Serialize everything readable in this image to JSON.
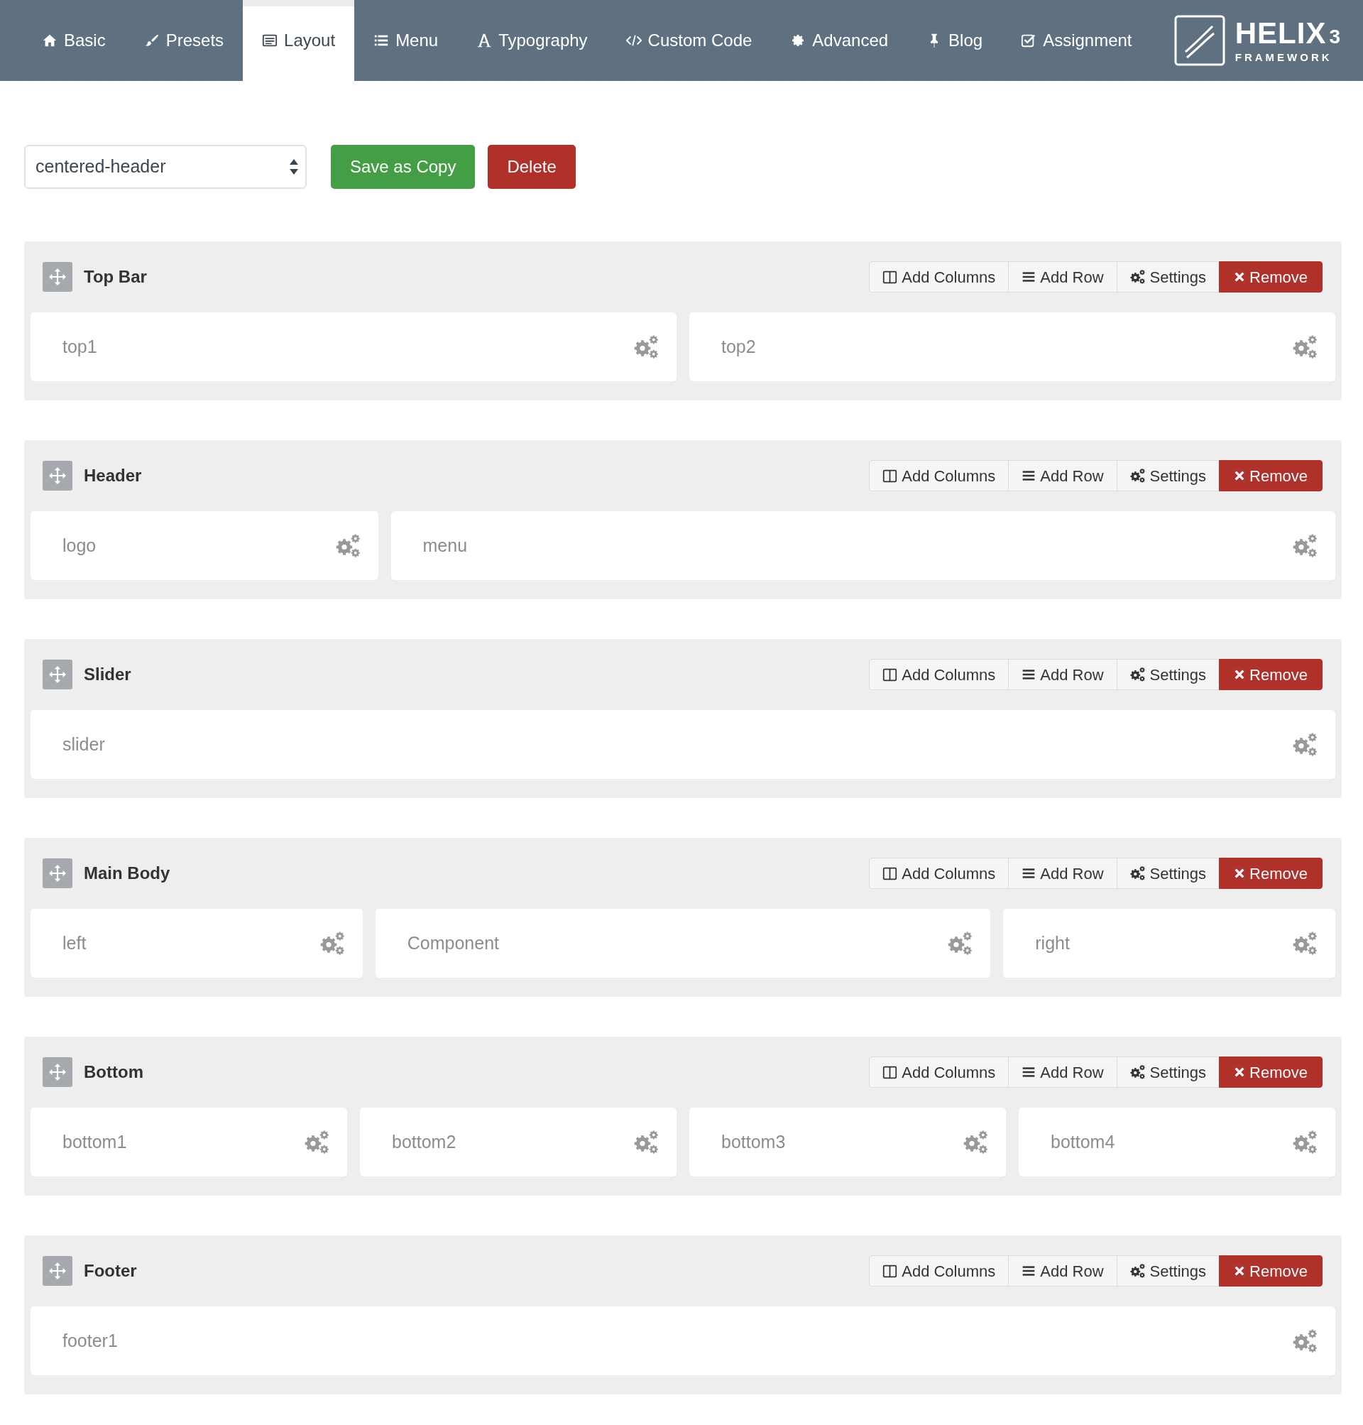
{
  "tabs": [
    {
      "label": "Basic",
      "kind": "home",
      "selected": false
    },
    {
      "label": "Presets",
      "kind": "brush",
      "selected": false
    },
    {
      "label": "Layout",
      "kind": "layout",
      "selected": true
    },
    {
      "label": "Menu",
      "kind": "list",
      "selected": false
    },
    {
      "label": "Typography",
      "kind": "font",
      "selected": false
    },
    {
      "label": "Custom Code",
      "kind": "code",
      "selected": false
    },
    {
      "label": "Advanced",
      "kind": "gear",
      "selected": false
    },
    {
      "label": "Blog",
      "kind": "pin",
      "selected": false
    },
    {
      "label": "Assignment",
      "kind": "check",
      "selected": false
    }
  ],
  "logo": {
    "name": "HELIX",
    "version": "3",
    "tagline": "FRAMEWORK"
  },
  "layout_select": {
    "value": "centered-header"
  },
  "actions": [
    {
      "label": "Save as Copy",
      "kind": "save"
    },
    {
      "label": "Delete",
      "kind": "delete"
    }
  ],
  "sections": [
    {
      "title": "Top Bar",
      "tools": [
        {
          "label": "Add Columns",
          "kind": "columns"
        },
        {
          "label": "Add Row",
          "kind": "row"
        },
        {
          "label": "Settings",
          "kind": "settings"
        },
        {
          "label": "Remove",
          "kind": "remove"
        }
      ],
      "columns": [
        {
          "name": "top1"
        },
        {
          "name": "top2"
        }
      ]
    },
    {
      "title": "Header",
      "tools": [
        {
          "label": "Add Columns",
          "kind": "columns"
        },
        {
          "label": "Add Row",
          "kind": "row"
        },
        {
          "label": "Settings",
          "kind": "settings"
        },
        {
          "label": "Remove",
          "kind": "remove"
        }
      ],
      "columns": [
        {
          "name": "logo"
        },
        {
          "name": "menu"
        }
      ]
    },
    {
      "title": "Slider",
      "tools": [
        {
          "label": "Add Columns",
          "kind": "columns"
        },
        {
          "label": "Add Row",
          "kind": "row"
        },
        {
          "label": "Settings",
          "kind": "settings"
        },
        {
          "label": "Remove",
          "kind": "remove"
        }
      ],
      "columns": [
        {
          "name": "slider"
        }
      ]
    },
    {
      "title": "Main Body",
      "tools": [
        {
          "label": "Add Columns",
          "kind": "columns"
        },
        {
          "label": "Add Row",
          "kind": "row"
        },
        {
          "label": "Settings",
          "kind": "settings"
        },
        {
          "label": "Remove",
          "kind": "remove"
        }
      ],
      "columns": [
        {
          "name": "left"
        },
        {
          "name": "Component"
        },
        {
          "name": "right"
        }
      ]
    },
    {
      "title": "Bottom",
      "tools": [
        {
          "label": "Add Columns",
          "kind": "columns"
        },
        {
          "label": "Add Row",
          "kind": "row"
        },
        {
          "label": "Settings",
          "kind": "settings"
        },
        {
          "label": "Remove",
          "kind": "remove"
        }
      ],
      "columns": [
        {
          "name": "bottom1"
        },
        {
          "name": "bottom2"
        },
        {
          "name": "bottom3"
        },
        {
          "name": "bottom4"
        }
      ]
    },
    {
      "title": "Footer",
      "tools": [
        {
          "label": "Add Columns",
          "kind": "columns"
        },
        {
          "label": "Add Row",
          "kind": "row"
        },
        {
          "label": "Settings",
          "kind": "settings"
        },
        {
          "label": "Remove",
          "kind": "remove"
        }
      ],
      "columns": [
        {
          "name": "footer1"
        }
      ]
    }
  ]
}
